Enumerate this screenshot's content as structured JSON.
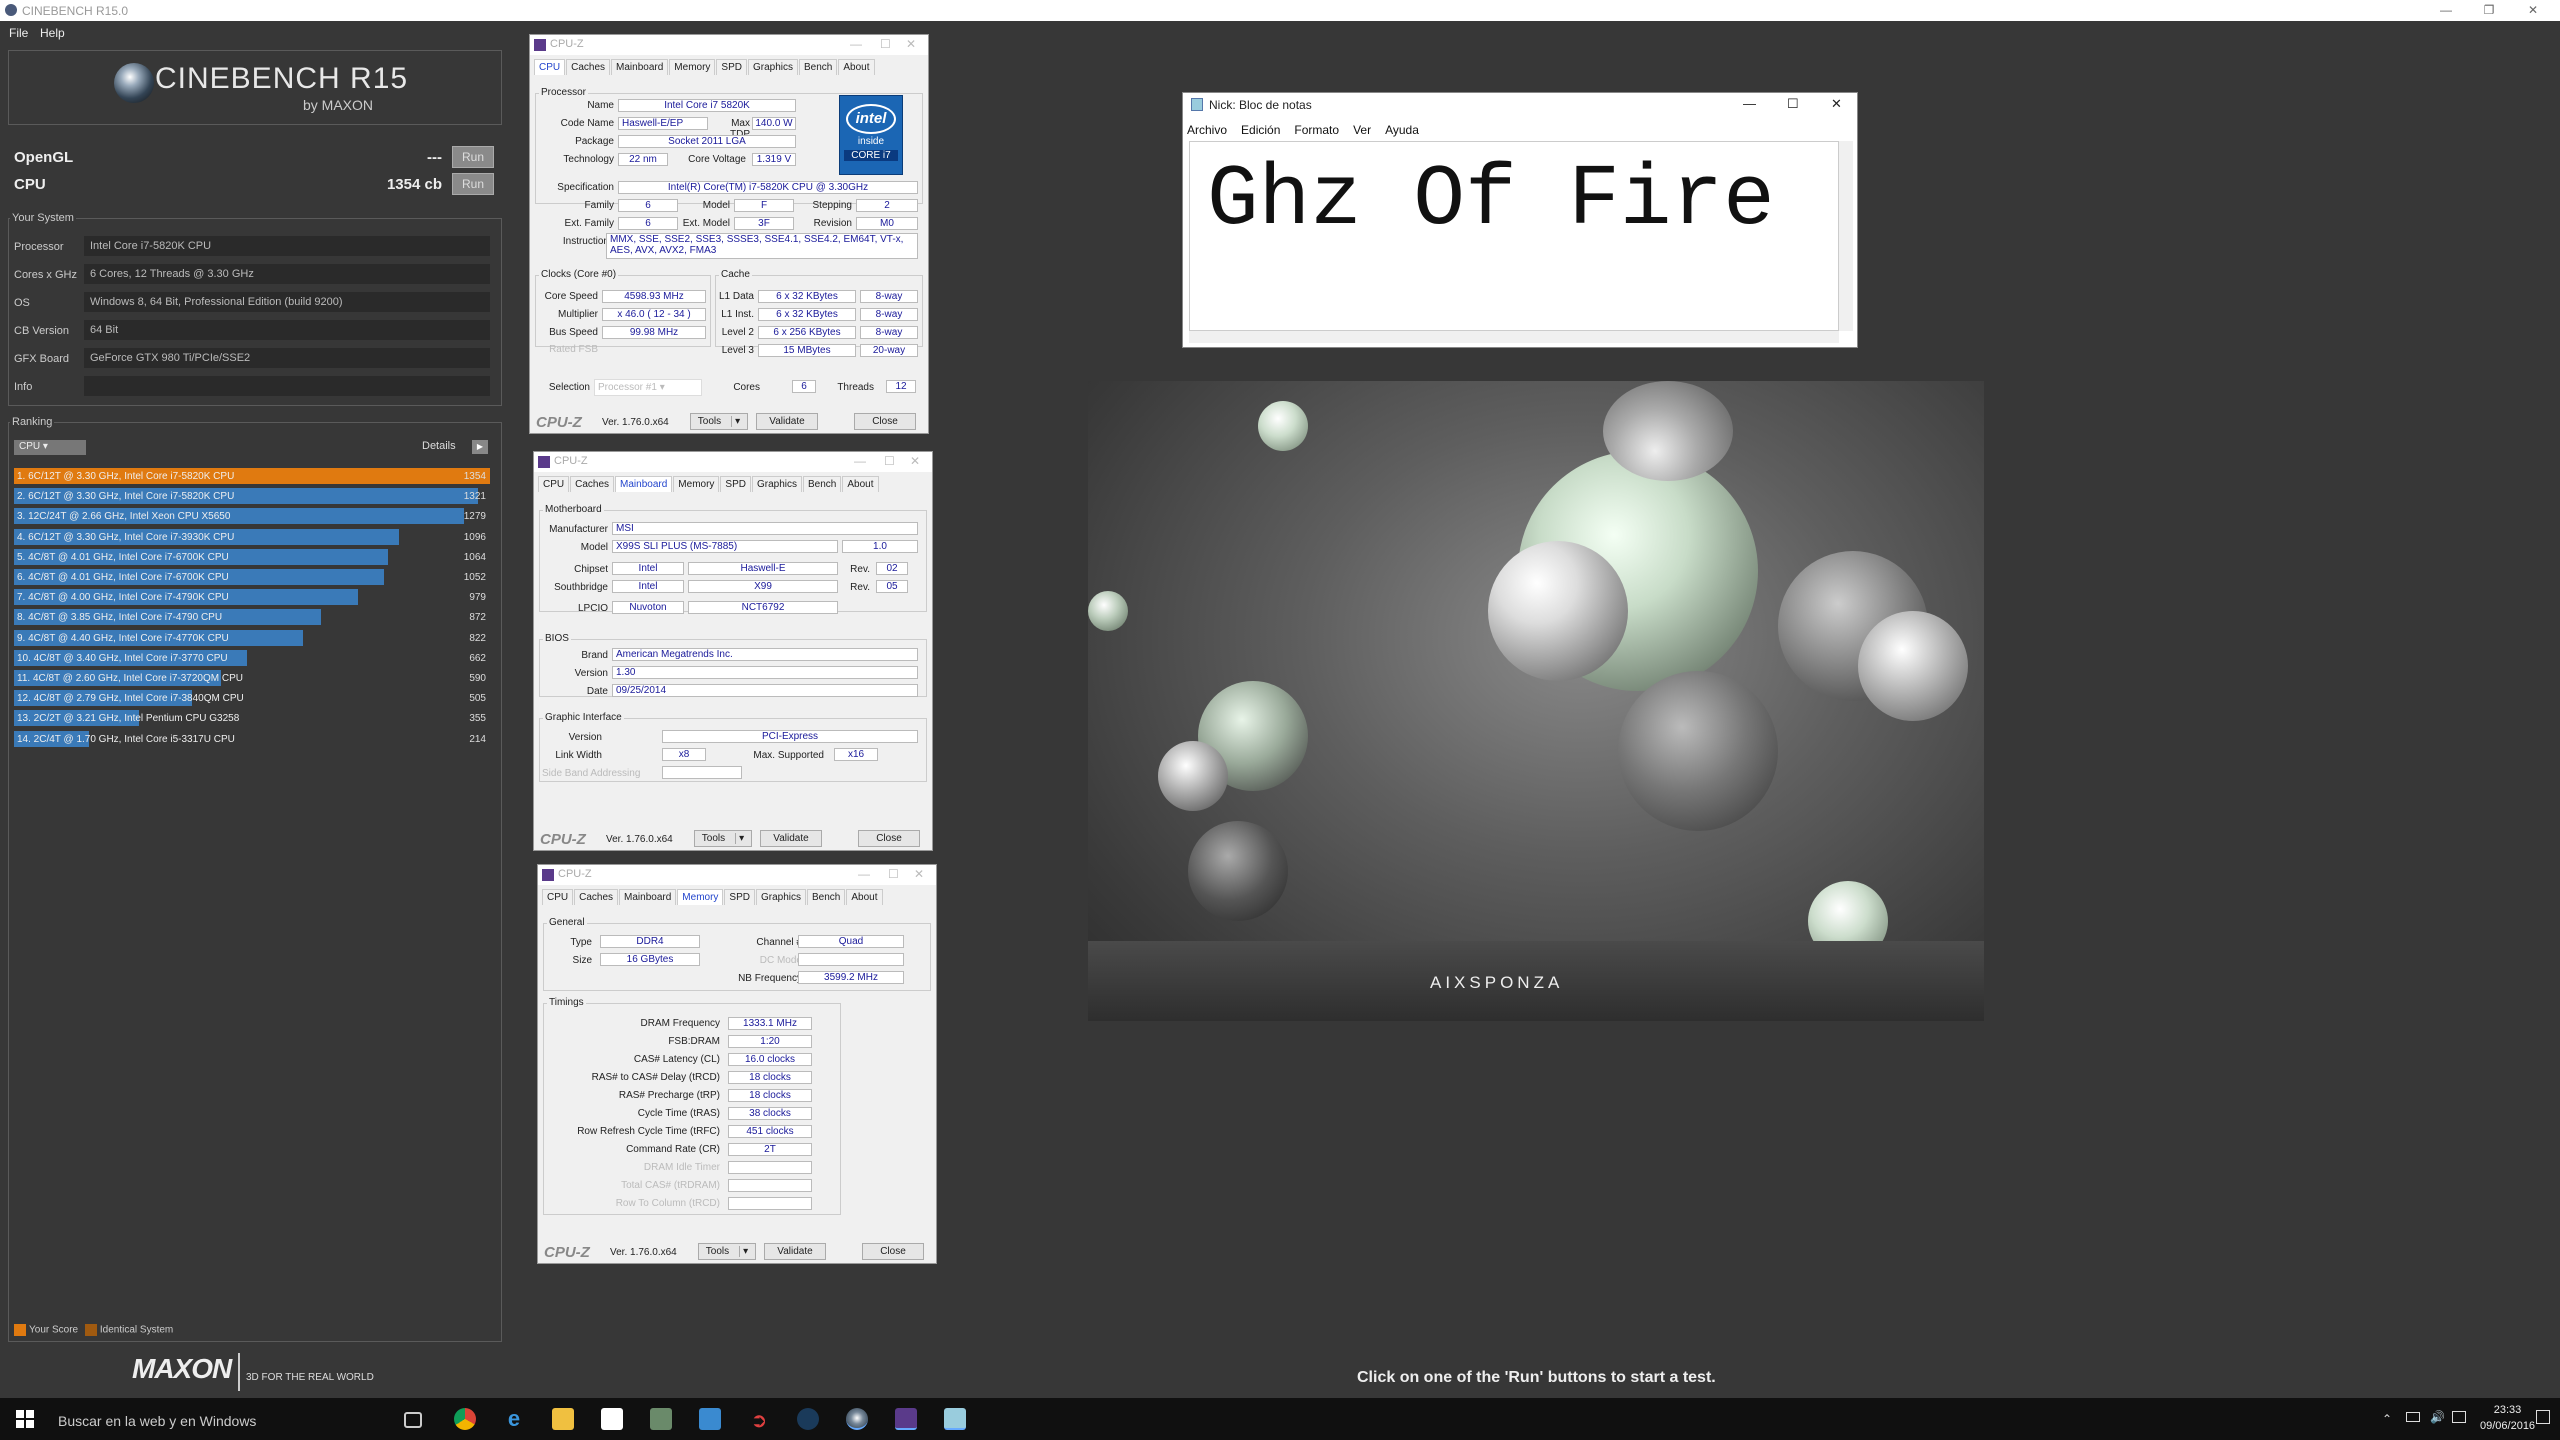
{
  "window": {
    "title": "CINEBENCH R15.0"
  },
  "menu": {
    "file": "File",
    "help": "Help"
  },
  "logo": {
    "name": "CINEBENCH R15",
    "sub": "by MAXON"
  },
  "scores": {
    "opengl": {
      "label": "OpenGL",
      "value": "---",
      "run": "Run"
    },
    "cpu": {
      "label": "CPU",
      "value": "1354 cb",
      "run": "Run"
    }
  },
  "system": {
    "title": "Your System",
    "rows": [
      {
        "k": "Processor",
        "v": "Intel Core i7-5820K CPU"
      },
      {
        "k": "Cores x GHz",
        "v": "6 Cores, 12 Threads @ 3.30 GHz"
      },
      {
        "k": "OS",
        "v": "Windows 8, 64 Bit, Professional Edition (build 9200)"
      },
      {
        "k": "CB Version",
        "v": "64 Bit"
      },
      {
        "k": "GFX Board",
        "v": "GeForce GTX 980 Ti/PCIe/SSE2"
      },
      {
        "k": "Info",
        "v": ""
      }
    ]
  },
  "ranking": {
    "title": "Ranking",
    "select": "CPU",
    "details": "Details",
    "rows": [
      {
        "label": "1. 6C/12T @ 3.30 GHz, Intel Core i7-5820K CPU",
        "score": "1354",
        "value": 1354,
        "highlight": true
      },
      {
        "label": "2. 6C/12T @ 3.30 GHz, Intel Core i7-5820K CPU",
        "score": "1321",
        "value": 1321
      },
      {
        "label": "3. 12C/24T @ 2.66 GHz, Intel Xeon CPU X5650",
        "score": "1279",
        "value": 1279
      },
      {
        "label": "4. 6C/12T @ 3.30 GHz,  Intel Core i7-3930K CPU",
        "score": "1096",
        "value": 1096
      },
      {
        "label": "5. 4C/8T @ 4.01 GHz, Intel Core i7-6700K CPU",
        "score": "1064",
        "value": 1064
      },
      {
        "label": "6. 4C/8T @ 4.01 GHz, Intel Core i7-6700K CPU",
        "score": "1052",
        "value": 1052
      },
      {
        "label": "7. 4C/8T @ 4.00 GHz, Intel Core i7-4790K CPU",
        "score": "979",
        "value": 979
      },
      {
        "label": "8. 4C/8T @ 3.85 GHz, Intel Core i7-4790 CPU",
        "score": "872",
        "value": 872
      },
      {
        "label": "9. 4C/8T @ 4.40 GHz, Intel Core i7-4770K CPU",
        "score": "822",
        "value": 822
      },
      {
        "label": "10. 4C/8T @ 3.40 GHz,  Intel Core i7-3770 CPU",
        "score": "662",
        "value": 662
      },
      {
        "label": "11. 4C/8T @ 2.60 GHz, Intel Core i7-3720QM CPU",
        "score": "590",
        "value": 590
      },
      {
        "label": "12. 4C/8T @ 2.79 GHz,  Intel Core i7-3840QM CPU",
        "score": "505",
        "value": 505
      },
      {
        "label": "13. 2C/2T @ 3.21 GHz, Intel Pentium CPU G3258",
        "score": "355",
        "value": 355
      },
      {
        "label": "14. 2C/4T @ 1.70 GHz,  Intel Core i5-3317U CPU",
        "score": "214",
        "value": 214
      }
    ],
    "legend": {
      "your": "Your Score",
      "identical": "Identical System"
    }
  },
  "colors": {
    "your_score": "#e07a10",
    "identical": "#a05a10",
    "bar": "#3a7ab8"
  },
  "footer": {
    "brand": "MAXON",
    "tagline": "3D FOR THE REAL WORLD",
    "message": "Click on one of the 'Run' buttons to start a test."
  },
  "cpuz_common": {
    "title": "CPU-Z",
    "brand": "CPU-Z",
    "version": "Ver. 1.76.0.x64",
    "tools": "Tools",
    "validate": "Validate",
    "close": "Close",
    "tabs": [
      "CPU",
      "Caches",
      "Mainboard",
      "Memory",
      "SPD",
      "Graphics",
      "Bench",
      "About"
    ]
  },
  "cpuz_cpu": {
    "processor": "Processor",
    "name_l": "Name",
    "name": "Intel Core i7 5820K",
    "codename_l": "Code Name",
    "codename": "Haswell-E/EP",
    "tdp_l": "Max TDP",
    "tdp": "140.0 W",
    "package_l": "Package",
    "package": "Socket 2011 LGA",
    "tech_l": "Technology",
    "tech": "22 nm",
    "cv_l": "Core Voltage",
    "cv": "1.319 V",
    "spec_l": "Specification",
    "spec": "Intel(R) Core(TM) i7-5820K CPU @ 3.30GHz",
    "family_l": "Family",
    "family": "6",
    "model_l": "Model",
    "model": "F",
    "stepping_l": "Stepping",
    "stepping": "2",
    "extfam_l": "Ext. Family",
    "extfam": "6",
    "extmod_l": "Ext. Model",
    "extmod": "3F",
    "rev_l": "Revision",
    "rev": "M0",
    "instr_l": "Instructions",
    "instr": "MMX, SSE, SSE2, SSE3, SSSE3, SSE4.1, SSE4.2, EM64T, VT-x, AES, AVX, AVX2, FMA3",
    "clocks": "Clocks (Core #0)",
    "cache": "Cache",
    "cs_l": "Core Speed",
    "cs": "4598.93 MHz",
    "mult_l": "Multiplier",
    "mult": "x 46.0 ( 12 - 34 )",
    "bus_l": "Bus Speed",
    "bus": "99.98 MHz",
    "rfsb_l": "Rated FSB",
    "l1d_l": "L1 Data",
    "l1d": "6 x 32 KBytes",
    "l1d_w": "8-way",
    "l1i_l": "L1 Inst.",
    "l1i": "6 x 32 KBytes",
    "l1i_w": "8-way",
    "l2_l": "Level 2",
    "l2": "6 x 256 KBytes",
    "l2_w": "8-way",
    "l3_l": "Level 3",
    "l3": "15 MBytes",
    "l3_w": "20-way",
    "sel_l": "Selection",
    "sel": "Processor #1",
    "cores_l": "Cores",
    "cores": "6",
    "threads_l": "Threads",
    "threads": "12",
    "intel": "intel",
    "inside": "inside",
    "corei7": "CORE i7"
  },
  "cpuz_mb": {
    "mb": "Motherboard",
    "man_l": "Manufacturer",
    "man": "MSI",
    "model_l": "Model",
    "model": "X99S SLI PLUS (MS-7885)",
    "model_rev": "1.0",
    "chip_l": "Chipset",
    "chip_v": "Intel",
    "chip_n": "Haswell-E",
    "rev_l": "Rev.",
    "chip_r": "02",
    "sb_l": "Southbridge",
    "sb_v": "Intel",
    "sb_n": "X99",
    "sb_r": "05",
    "lpc_l": "LPCIO",
    "lpc_v": "Nuvoton",
    "lpc_n": "NCT6792",
    "bios": "BIOS",
    "brand_l": "Brand",
    "brand": "American Megatrends Inc.",
    "ver_l": "Version",
    "ver": "1.30",
    "date_l": "Date",
    "date": "09/25/2014",
    "gi": "Graphic Interface",
    "giv_l": "Version",
    "giv": "PCI-Express",
    "lw_l": "Link Width",
    "lw": "x8",
    "ms_l": "Max. Supported",
    "ms": "x16",
    "sba_l": "Side Band Addressing"
  },
  "cpuz_mem": {
    "general": "General",
    "type_l": "Type",
    "type": "DDR4",
    "size_l": "Size",
    "size": "16 GBytes",
    "ch_l": "Channel #",
    "ch": "Quad",
    "dc_l": "DC Mode",
    "nb_l": "NB Frequency",
    "nb": "3599.2 MHz",
    "timings": "Timings",
    "rows": [
      {
        "k": "DRAM Frequency",
        "v": "1333.1 MHz"
      },
      {
        "k": "FSB:DRAM",
        "v": "1:20"
      },
      {
        "k": "CAS# Latency (CL)",
        "v": "16.0 clocks"
      },
      {
        "k": "RAS# to CAS# Delay (tRCD)",
        "v": "18 clocks"
      },
      {
        "k": "RAS# Precharge (tRP)",
        "v": "18 clocks"
      },
      {
        "k": "Cycle Time (tRAS)",
        "v": "38 clocks"
      },
      {
        "k": "Row Refresh Cycle Time (tRFC)",
        "v": "451 clocks"
      },
      {
        "k": "Command Rate (CR)",
        "v": "2T"
      },
      {
        "k": "DRAM Idle Timer",
        "v": "",
        "dis": true
      },
      {
        "k": "Total CAS# (tRDRAM)",
        "v": "",
        "dis": true
      },
      {
        "k": "Row To Column (tRCD)",
        "v": "",
        "dis": true
      }
    ]
  },
  "notepad": {
    "title": "Nick: Bloc de notas",
    "menu": [
      "Archivo",
      "Edición",
      "Formato",
      "Ver",
      "Ayuda"
    ],
    "content": "Ghz Of Fire"
  },
  "render": {
    "watermark": "AIXSPONZA"
  },
  "taskbar": {
    "search": "Buscar en la web y en Windows",
    "time": "23:33",
    "date": "09/06/2016"
  }
}
